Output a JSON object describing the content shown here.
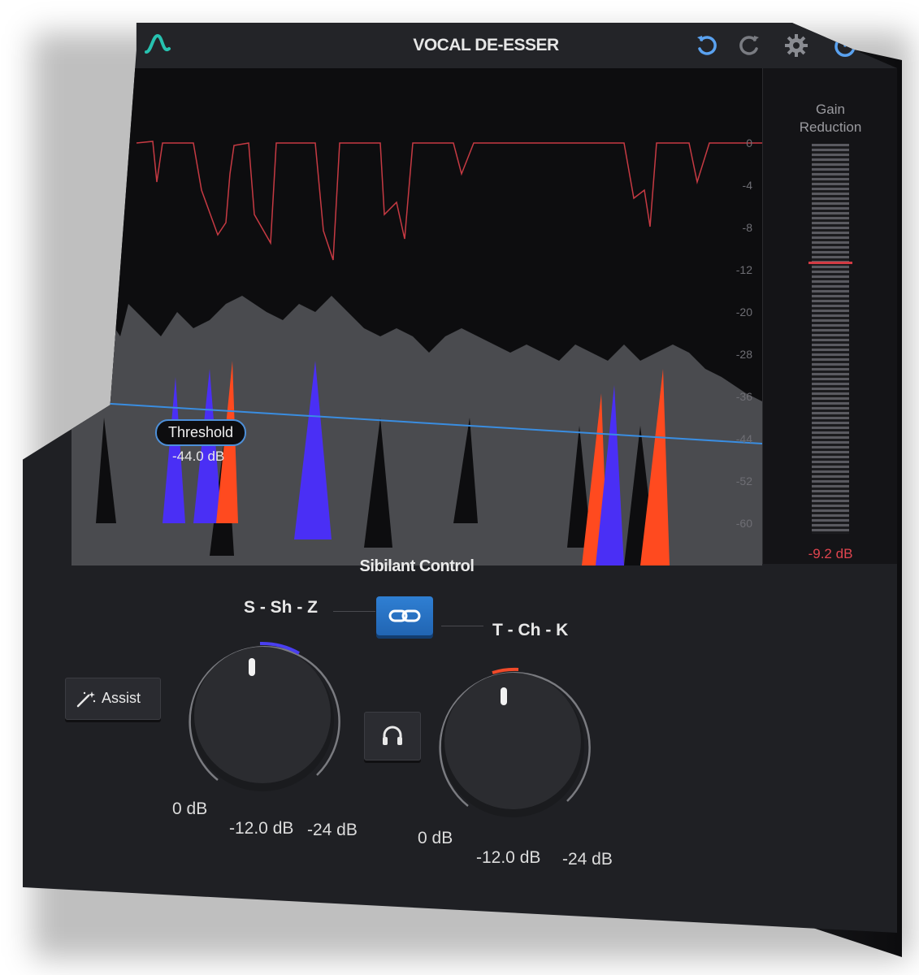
{
  "header": {
    "title": "VOCAL DE-ESSER",
    "buttons": [
      "undo-icon",
      "redo-icon",
      "gear-icon",
      "power-icon"
    ]
  },
  "display": {
    "gain_reduction_title_line1": "Gain",
    "gain_reduction_title_line2": "Reduction",
    "gain_reduction_value": "-9.2 dB",
    "scale": [
      "0",
      "-4",
      "-8",
      "-12",
      "-20",
      "-28",
      "-36",
      "-44",
      "-52",
      "-60"
    ],
    "threshold_label": "Threshold",
    "threshold_value": "-44.0 dB"
  },
  "controls": {
    "section_title": "Sibilant Control",
    "band1_label": "S - Sh - Z",
    "band2_label": "T - Ch - K",
    "assist_label": "Assist",
    "knob1": {
      "min_label": "0 dB",
      "value_label": "-12.0 dB",
      "max_label": "-24 dB",
      "accent": "#4a3ff0"
    },
    "knob2": {
      "min_label": "0 dB",
      "value_label": "-12.0 dB",
      "max_label": "-24 dB",
      "accent": "#f04a2a"
    }
  },
  "colors": {
    "accent_blue": "#2f7fd3",
    "gain_red": "#d33b44",
    "sibilant_blue": "#4a2ff5",
    "sibilant_orange": "#ff4a1f",
    "teal_logo": "#27c2b0"
  }
}
